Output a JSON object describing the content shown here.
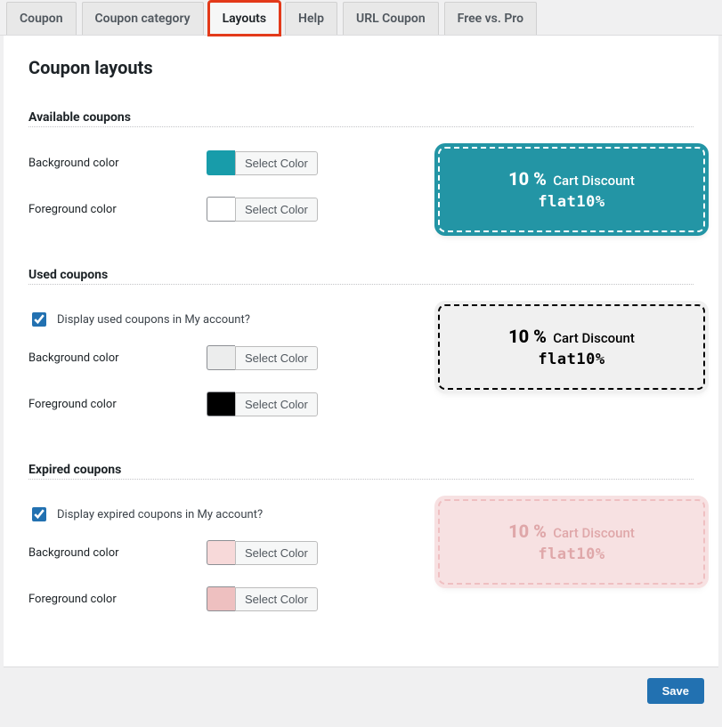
{
  "tabs": {
    "coupon": "Coupon",
    "category": "Coupon category",
    "layouts": "Layouts",
    "help": "Help",
    "url": "URL Coupon",
    "freepro": "Free vs. Pro"
  },
  "page": {
    "title": "Coupon layouts"
  },
  "labels": {
    "bg": "Background color",
    "fg": "Foreground color",
    "select": "Select Color"
  },
  "available": {
    "title": "Available coupons"
  },
  "used": {
    "title": "Used coupons",
    "checkbox": "Display used coupons in My account?"
  },
  "expired": {
    "title": "Expired coupons",
    "checkbox": "Display expired coupons in My account?"
  },
  "preview": {
    "percent": "10 %",
    "discount": "Cart Discount",
    "code": "flat10%"
  },
  "footer": {
    "save": "Save"
  }
}
